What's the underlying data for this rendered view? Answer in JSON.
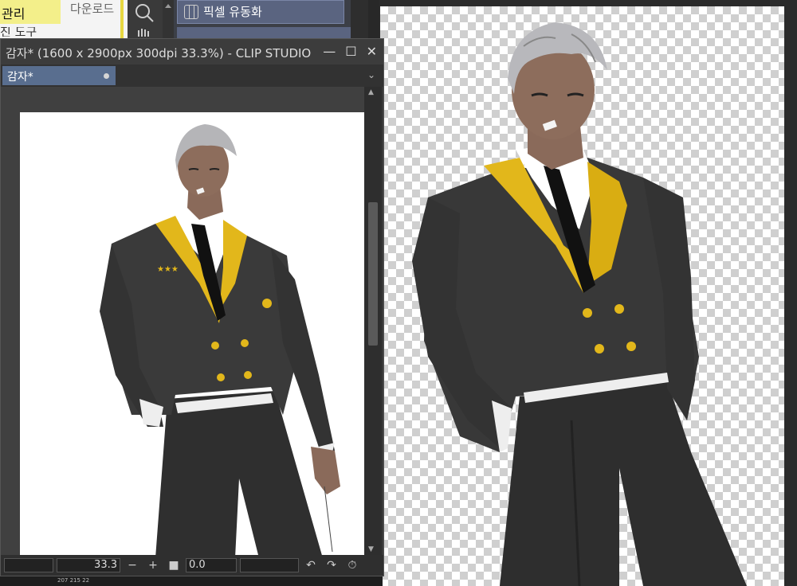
{
  "background_panel": {
    "tab_manage": "관리",
    "tab_download": "다운로드",
    "tab_cut_text": "진 도구"
  },
  "layer_panel": {
    "layer_name": "픽셀 유동화"
  },
  "subwindow": {
    "title": "감자* (1600 x 2900px 300dpi 33.3%)  - CLIP STUDIO",
    "doc_tab": "감자*",
    "zoom_value": "33.3",
    "rotation_value": "0.0"
  },
  "status_colors": {
    "readout": "207 215 22"
  },
  "colors": {
    "accent_tab": "#596e8f",
    "layer_highlight": "#5a6480",
    "jacket": "#3a3a3a",
    "lapel": "#e2b71b"
  }
}
